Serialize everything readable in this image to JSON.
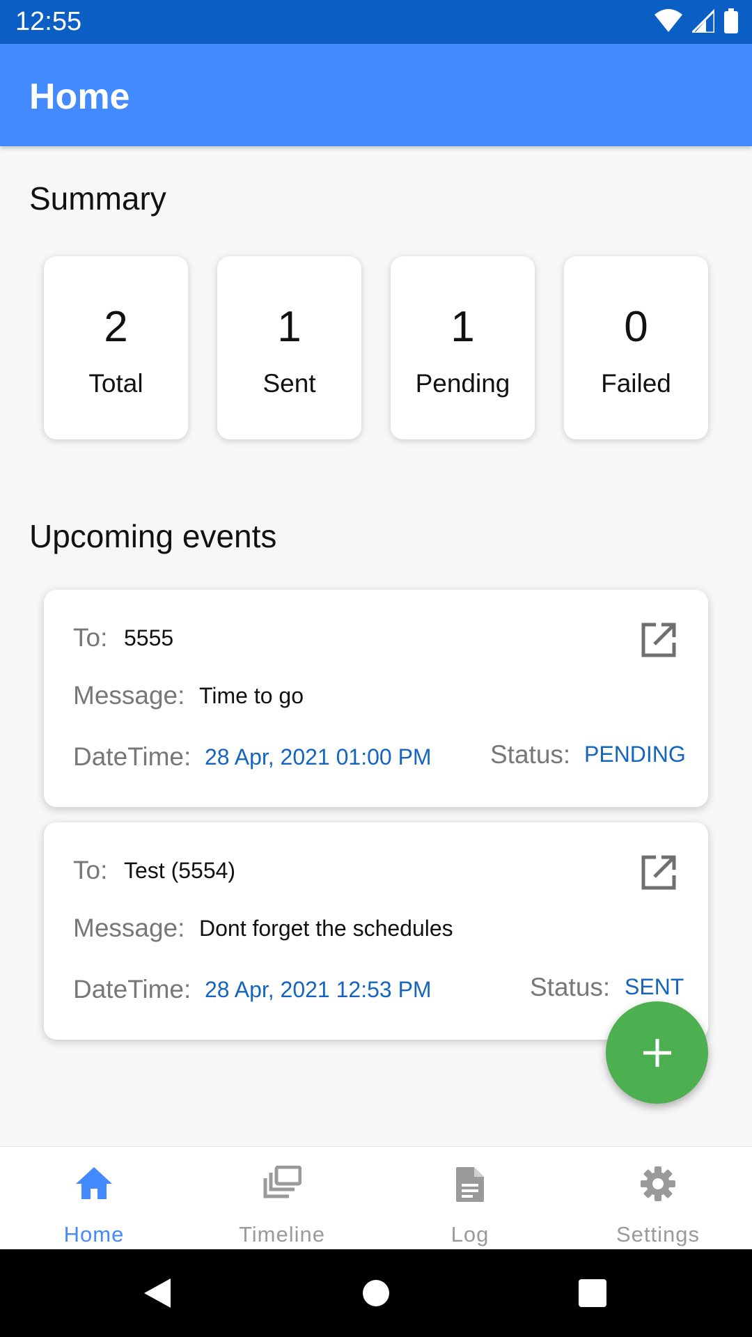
{
  "status_bar": {
    "time": "12:55"
  },
  "app_bar": {
    "title": "Home"
  },
  "summary": {
    "title": "Summary",
    "cards": [
      {
        "value": "2",
        "label": "Total"
      },
      {
        "value": "1",
        "label": "Sent"
      },
      {
        "value": "1",
        "label": "Pending"
      },
      {
        "value": "0",
        "label": "Failed"
      }
    ]
  },
  "upcoming": {
    "title": "Upcoming events",
    "labels": {
      "to": "To:",
      "message": "Message:",
      "datetime": "DateTime:",
      "status": "Status:"
    },
    "events": [
      {
        "to": "5555",
        "message": "Time to go",
        "datetime": "28 Apr, 2021 01:00 PM",
        "status": "PENDING"
      },
      {
        "to": "Test (5554)",
        "message": "Dont forget the schedules",
        "datetime": "28 Apr, 2021 12:53 PM",
        "status": "SENT"
      }
    ]
  },
  "fab": {
    "icon": "plus-icon",
    "color": "#4caf50"
  },
  "bottom_nav": {
    "items": [
      {
        "label": "Home",
        "icon": "home-icon",
        "active": true
      },
      {
        "label": "Timeline",
        "icon": "timeline-icon",
        "active": false
      },
      {
        "label": "Log",
        "icon": "document-icon",
        "active": false
      },
      {
        "label": "Settings",
        "icon": "gear-icon",
        "active": false
      }
    ]
  },
  "colors": {
    "status_bar": "#0b5fc4",
    "app_bar": "#448aff",
    "accent_blue": "#1565c0",
    "fab": "#4caf50"
  }
}
